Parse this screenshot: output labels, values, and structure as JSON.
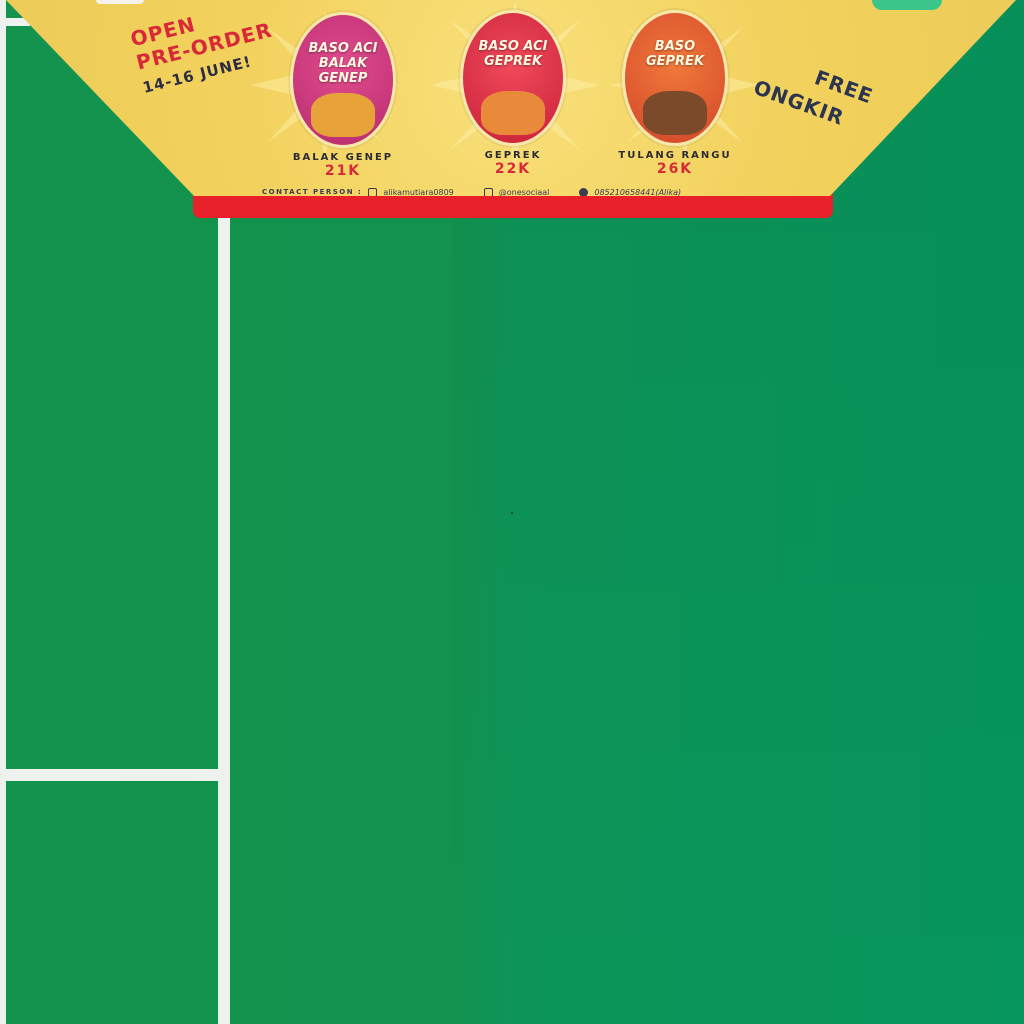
{
  "scene": {
    "type": "photo",
    "surface": "green sports court floor with white boundary lines",
    "colors": {
      "court": "#12924e",
      "lines": "#eef2ee",
      "banner": "#f2d15c",
      "banner_trim": "#e8202a"
    }
  },
  "banner": {
    "open_line1": "OPEN",
    "open_line2": "PRE-ORDER",
    "open_line3": "14-16 JUNE!",
    "free_line1": "FREE",
    "free_line2": "ONGKIR",
    "products": [
      {
        "pack_label": "BASO ACI BALAK GENEP",
        "name": "BALAK GENEP",
        "price": "21K",
        "color": "#d9407e"
      },
      {
        "pack_label": "BASO ACI GEPREK",
        "name": "GEPREK",
        "price": "22K",
        "color": "#e23448"
      },
      {
        "pack_label": "BASO GEPREK",
        "name": "TULANG RANGU",
        "price": "26K",
        "color": "#e8602e"
      }
    ],
    "contact": {
      "label": "CONTACT PERSON :",
      "instagram_1": "alikamutiara0809",
      "instagram_2": "@onesociaal",
      "phone": "085210658441(Alika)",
      "icons": [
        "instagram-icon",
        "instagram-icon",
        "whatsapp-icon"
      ]
    }
  }
}
